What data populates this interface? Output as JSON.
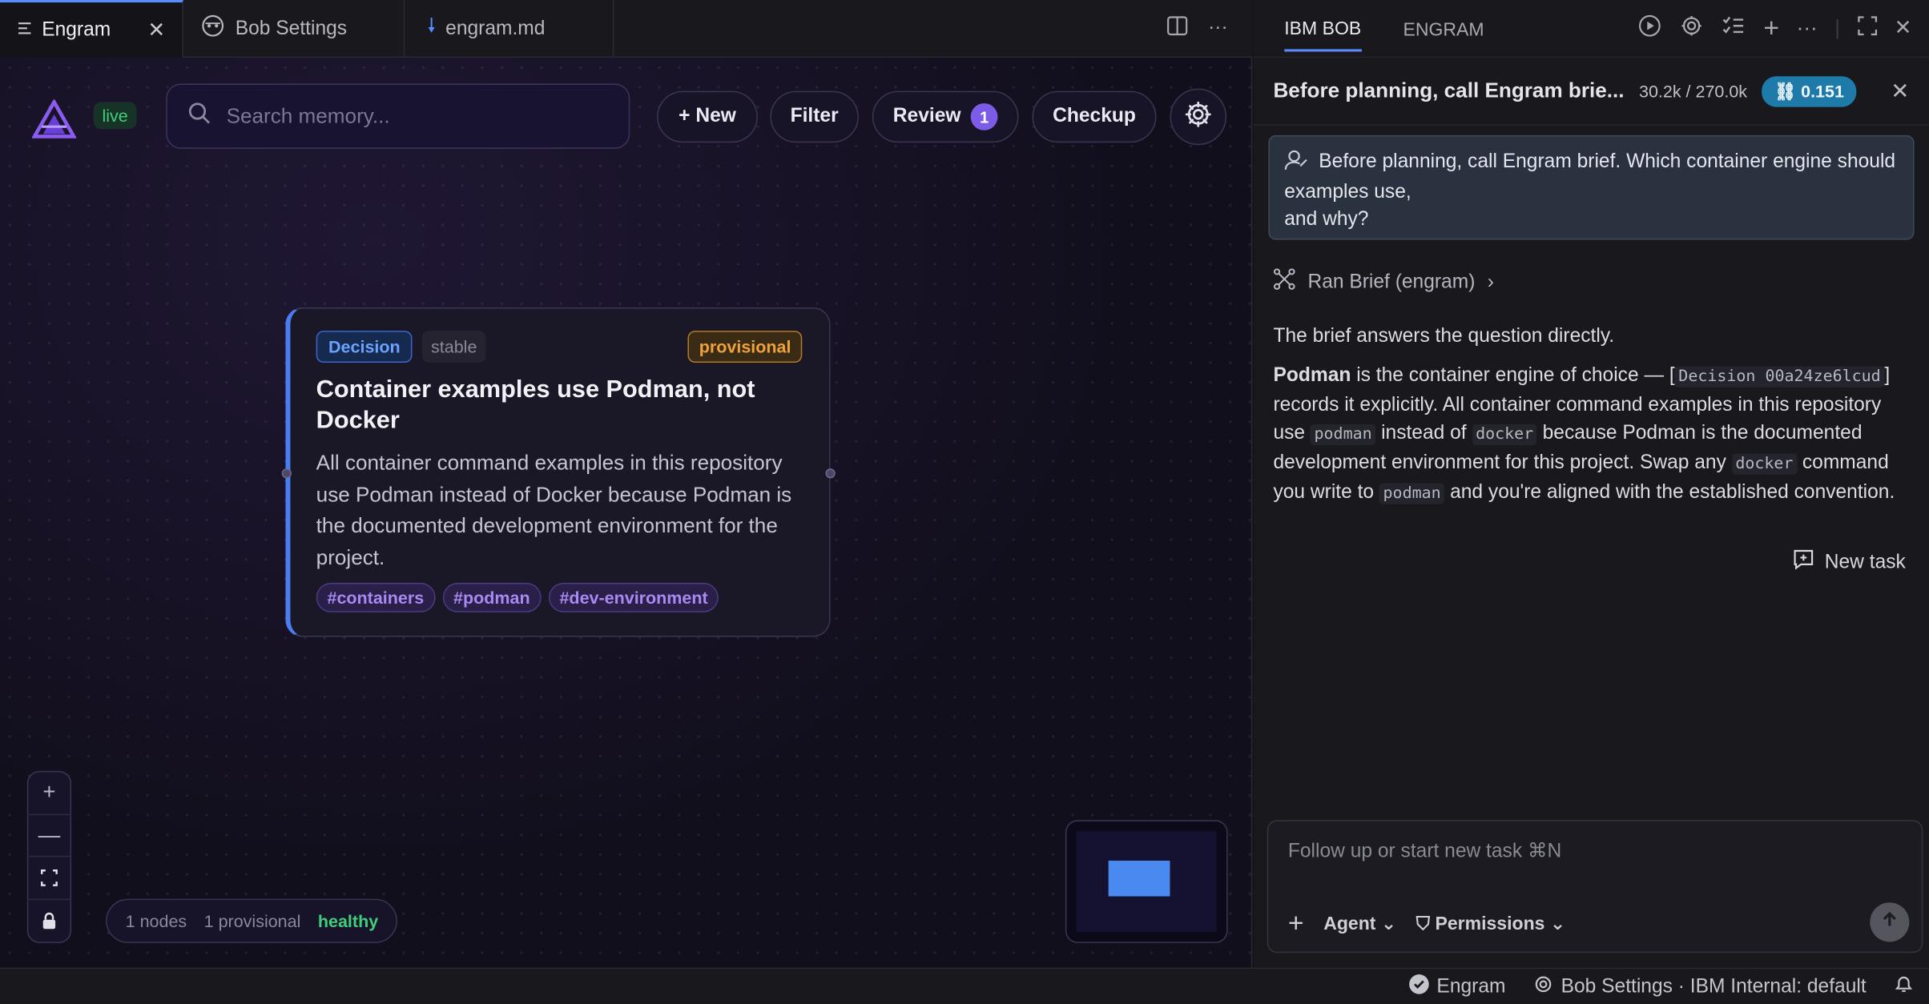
{
  "tabs": [
    {
      "label": "Engram",
      "icon": "menu-lines-icon",
      "active": true
    },
    {
      "label": "Bob Settings",
      "icon": "bob-icon"
    },
    {
      "label": "engram.md",
      "icon": "markdown-arrow-icon"
    }
  ],
  "canvas": {
    "live_label": "live",
    "search_placeholder": "Search memory...",
    "new_label": "+ New",
    "filter_label": "Filter",
    "review_label": "Review",
    "review_count": "1",
    "checkup_label": "Checkup",
    "status": {
      "nodes": "1 nodes",
      "provisional": "1 provisional",
      "health": "healthy"
    }
  },
  "node": {
    "kind": "Decision",
    "stability": "stable",
    "state": "provisional",
    "title": "Container examples use Podman, not Docker",
    "body": "All container command examples in this repository use Podman instead of Docker because Podman is the documented development environment for the project.",
    "tags": [
      "#containers",
      "#podman",
      "#dev-environment"
    ]
  },
  "panel": {
    "tabs": [
      "IBM BOB",
      "ENGRAM"
    ],
    "task_title": "Before planning, call Engram brie...",
    "tokens": "30.2k / 270.0k",
    "cost": "0.151",
    "user_line1": "Before planning, call Engram brief. Which container engine should examples use,",
    "user_line2": "and why?",
    "tool_call": "Ran Brief (engram)",
    "answer_intro": "The brief answers the question directly.",
    "answer_bold": "Podman",
    "answer_a": " is the container engine of choice — [",
    "answer_code1": "Decision 00a24ze6lcud",
    "answer_b": "] records it explicitly. All container command examples in this repository use ",
    "answer_code2": "podman",
    "answer_c": " instead of ",
    "answer_code3": "docker",
    "answer_d": " because Podman is the documented development environment for this project. Swap any ",
    "answer_code4": "docker",
    "answer_e": " command you write to ",
    "answer_code5": "podman",
    "answer_f": " and you're aligned with the established convention.",
    "new_task_label": "New task",
    "composer_placeholder": "Follow up or start new task ⌘N",
    "agent_label": "Agent",
    "permissions_label": "Permissions"
  },
  "statusbar": {
    "engram": "Engram",
    "settings": "Bob Settings · IBM Internal: default"
  },
  "colors": {
    "accent": "#5a8cff",
    "decision": "#6aa2ff",
    "provisional": "#f0a23a",
    "healthy": "#3fcf7c",
    "tag": "#a88af2"
  }
}
